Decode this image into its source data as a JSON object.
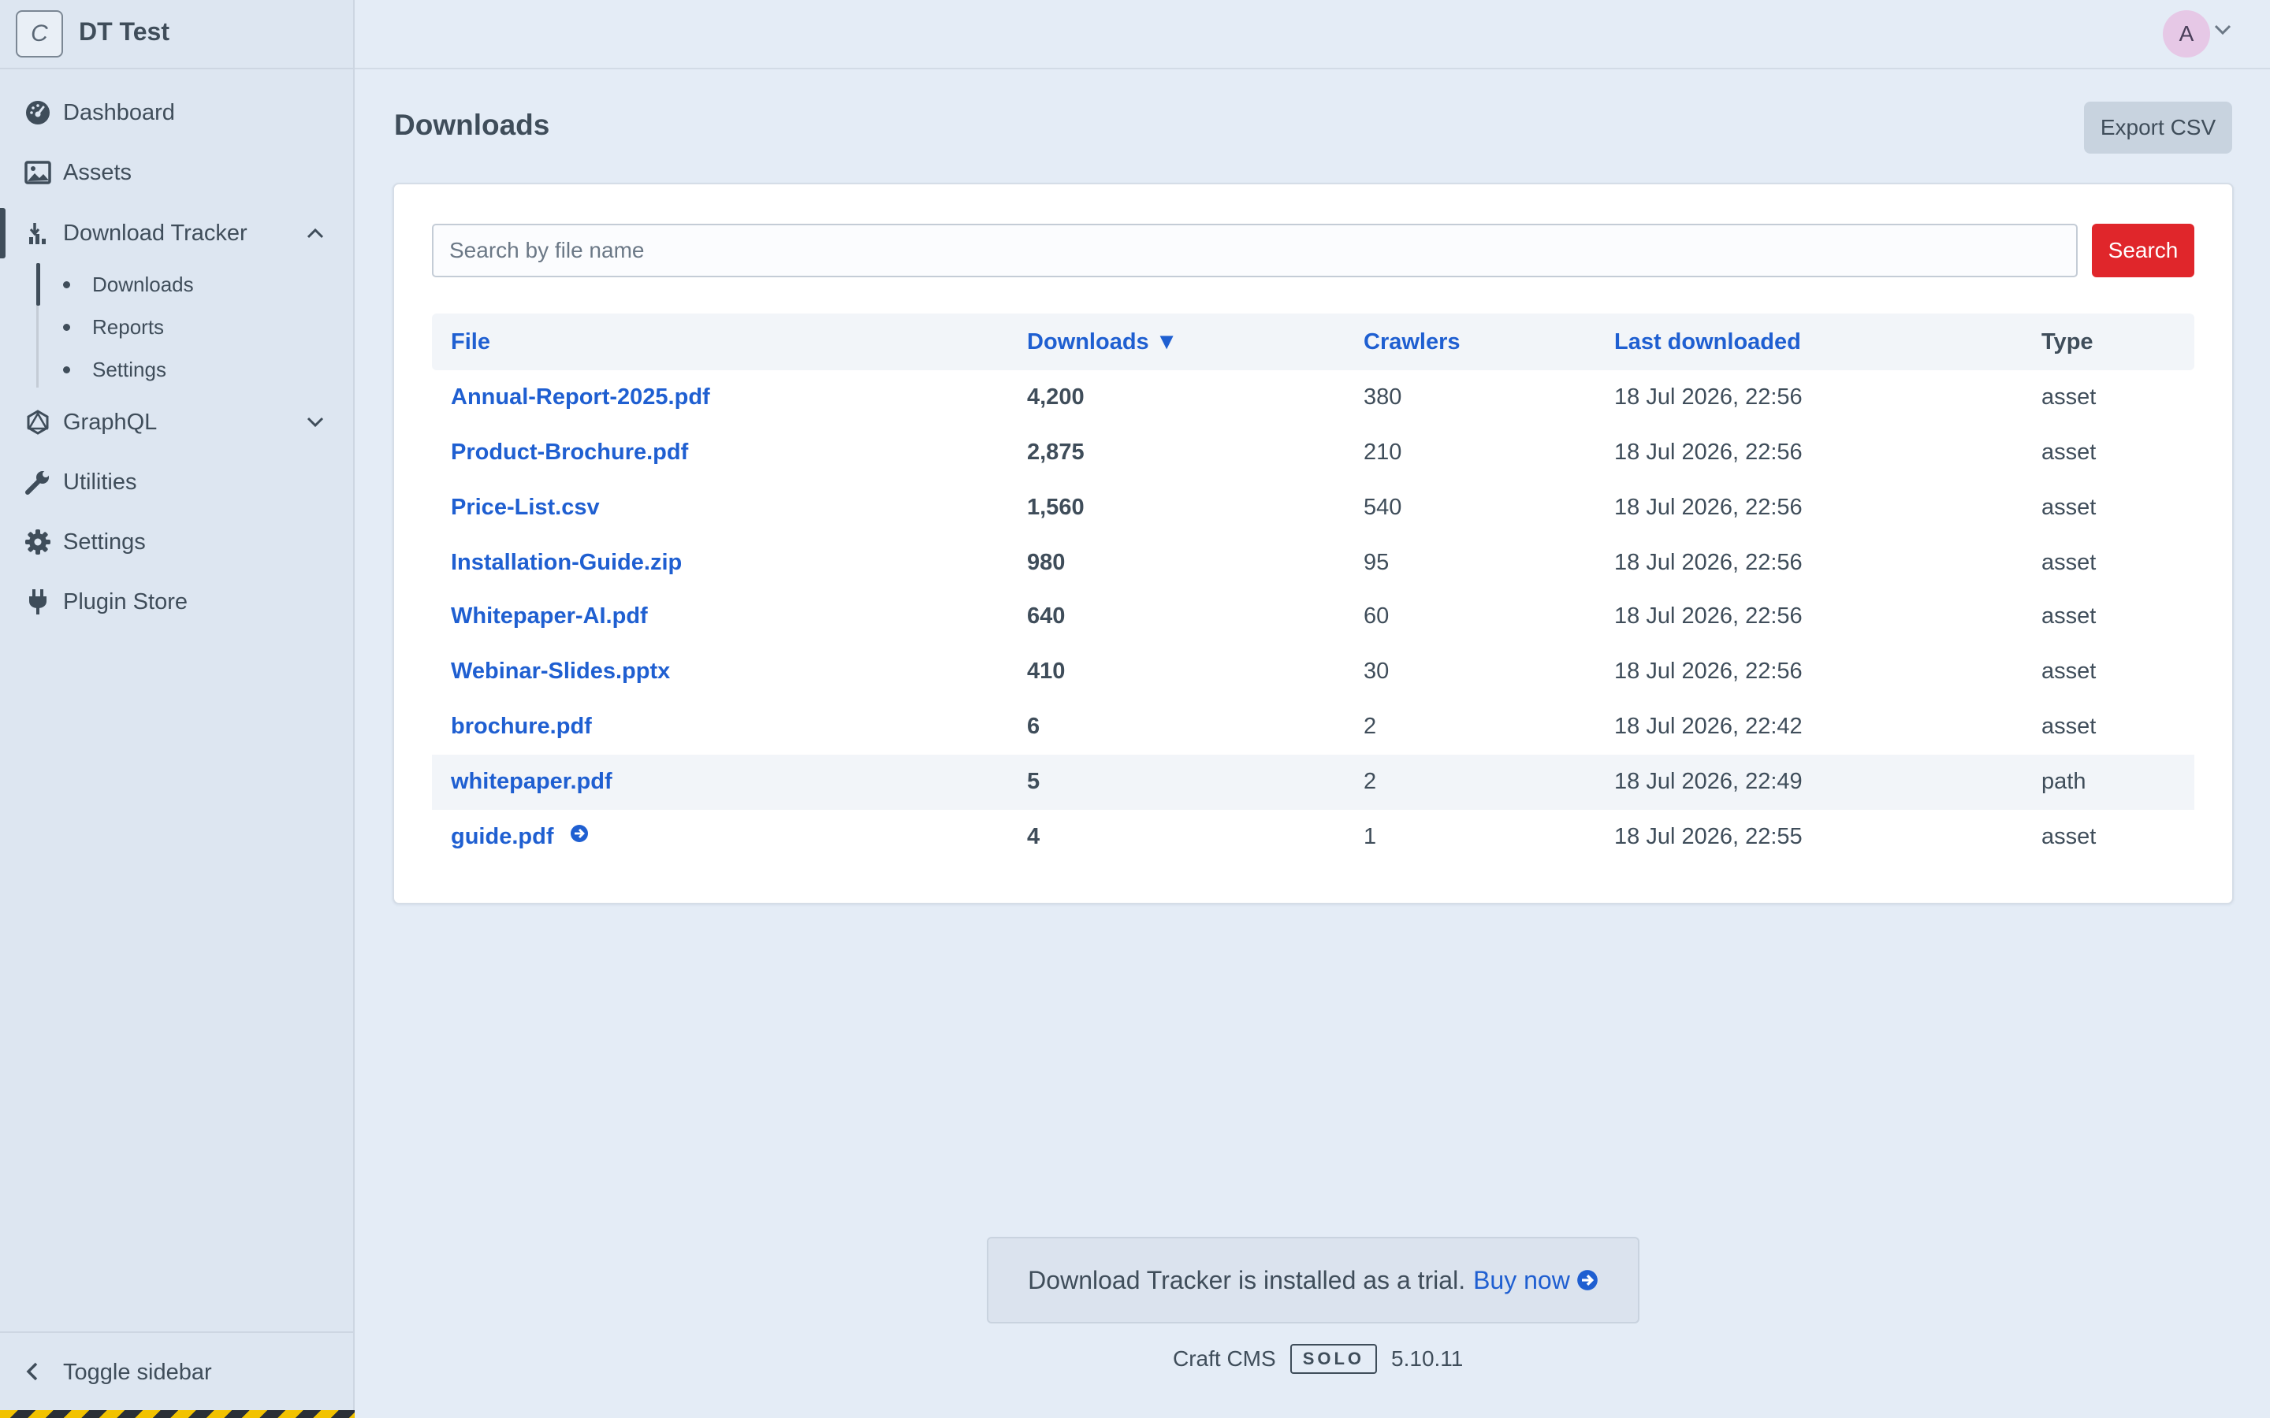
{
  "brand": {
    "logo_letter": "C",
    "name": "DT Test"
  },
  "sidebar": {
    "items": [
      {
        "label": "Dashboard",
        "icon": "gauge-icon"
      },
      {
        "label": "Assets",
        "icon": "image-icon"
      },
      {
        "label": "Download Tracker",
        "icon": "download-tracker-icon",
        "expanded": true
      },
      {
        "label": "GraphQL",
        "icon": "graphql-icon",
        "expanded": false
      },
      {
        "label": "Utilities",
        "icon": "wrench-icon"
      },
      {
        "label": "Settings",
        "icon": "gear-icon"
      },
      {
        "label": "Plugin Store",
        "icon": "plug-icon"
      }
    ],
    "subitems": [
      {
        "label": "Downloads",
        "active": true
      },
      {
        "label": "Reports"
      },
      {
        "label": "Settings"
      }
    ],
    "toggle_label": "Toggle sidebar"
  },
  "header": {
    "avatar_letter": "A"
  },
  "page": {
    "title": "Downloads",
    "export_label": "Export CSV"
  },
  "search": {
    "placeholder": "Search by file name",
    "value": "",
    "button_label": "Search"
  },
  "table": {
    "columns": {
      "file": "File",
      "downloads": "Downloads ▼",
      "crawlers": "Crawlers",
      "last": "Last downloaded",
      "type": "Type"
    },
    "rows": [
      {
        "file": "Annual-Report-2025.pdf",
        "downloads": "4,200",
        "crawlers": "380",
        "last": "18 Jul 2026, 22:56",
        "type": "asset"
      },
      {
        "file": "Product-Brochure.pdf",
        "downloads": "2,875",
        "crawlers": "210",
        "last": "18 Jul 2026, 22:56",
        "type": "asset"
      },
      {
        "file": "Price-List.csv",
        "downloads": "1,560",
        "crawlers": "540",
        "last": "18 Jul 2026, 22:56",
        "type": "asset"
      },
      {
        "file": "Installation-Guide.zip",
        "downloads": "980",
        "crawlers": "95",
        "last": "18 Jul 2026, 22:56",
        "type": "asset"
      },
      {
        "file": "Whitepaper-AI.pdf",
        "downloads": "640",
        "crawlers": "60",
        "last": "18 Jul 2026, 22:56",
        "type": "asset"
      },
      {
        "file": "Webinar-Slides.pptx",
        "downloads": "410",
        "crawlers": "30",
        "last": "18 Jul 2026, 22:56",
        "type": "asset"
      },
      {
        "file": "brochure.pdf",
        "downloads": "6",
        "crawlers": "2",
        "last": "18 Jul 2026, 22:42",
        "type": "asset"
      },
      {
        "file": "whitepaper.pdf",
        "downloads": "5",
        "crawlers": "2",
        "last": "18 Jul 2026, 22:49",
        "type": "path",
        "highlighted": true
      },
      {
        "file": "guide.pdf",
        "downloads": "4",
        "crawlers": "1",
        "last": "18 Jul 2026, 22:55",
        "type": "asset",
        "redirect": true
      }
    ]
  },
  "trial": {
    "message": "Download Tracker is installed as a trial.",
    "buy_label": "Buy now"
  },
  "footer": {
    "product": "Craft CMS",
    "edition": "SOLO",
    "version": "5.10.11"
  },
  "colors": {
    "accent_link": "#1f5fd1",
    "danger_button": "#e0262b",
    "text": "#3f4d5a",
    "background": "#e4ecf6"
  }
}
